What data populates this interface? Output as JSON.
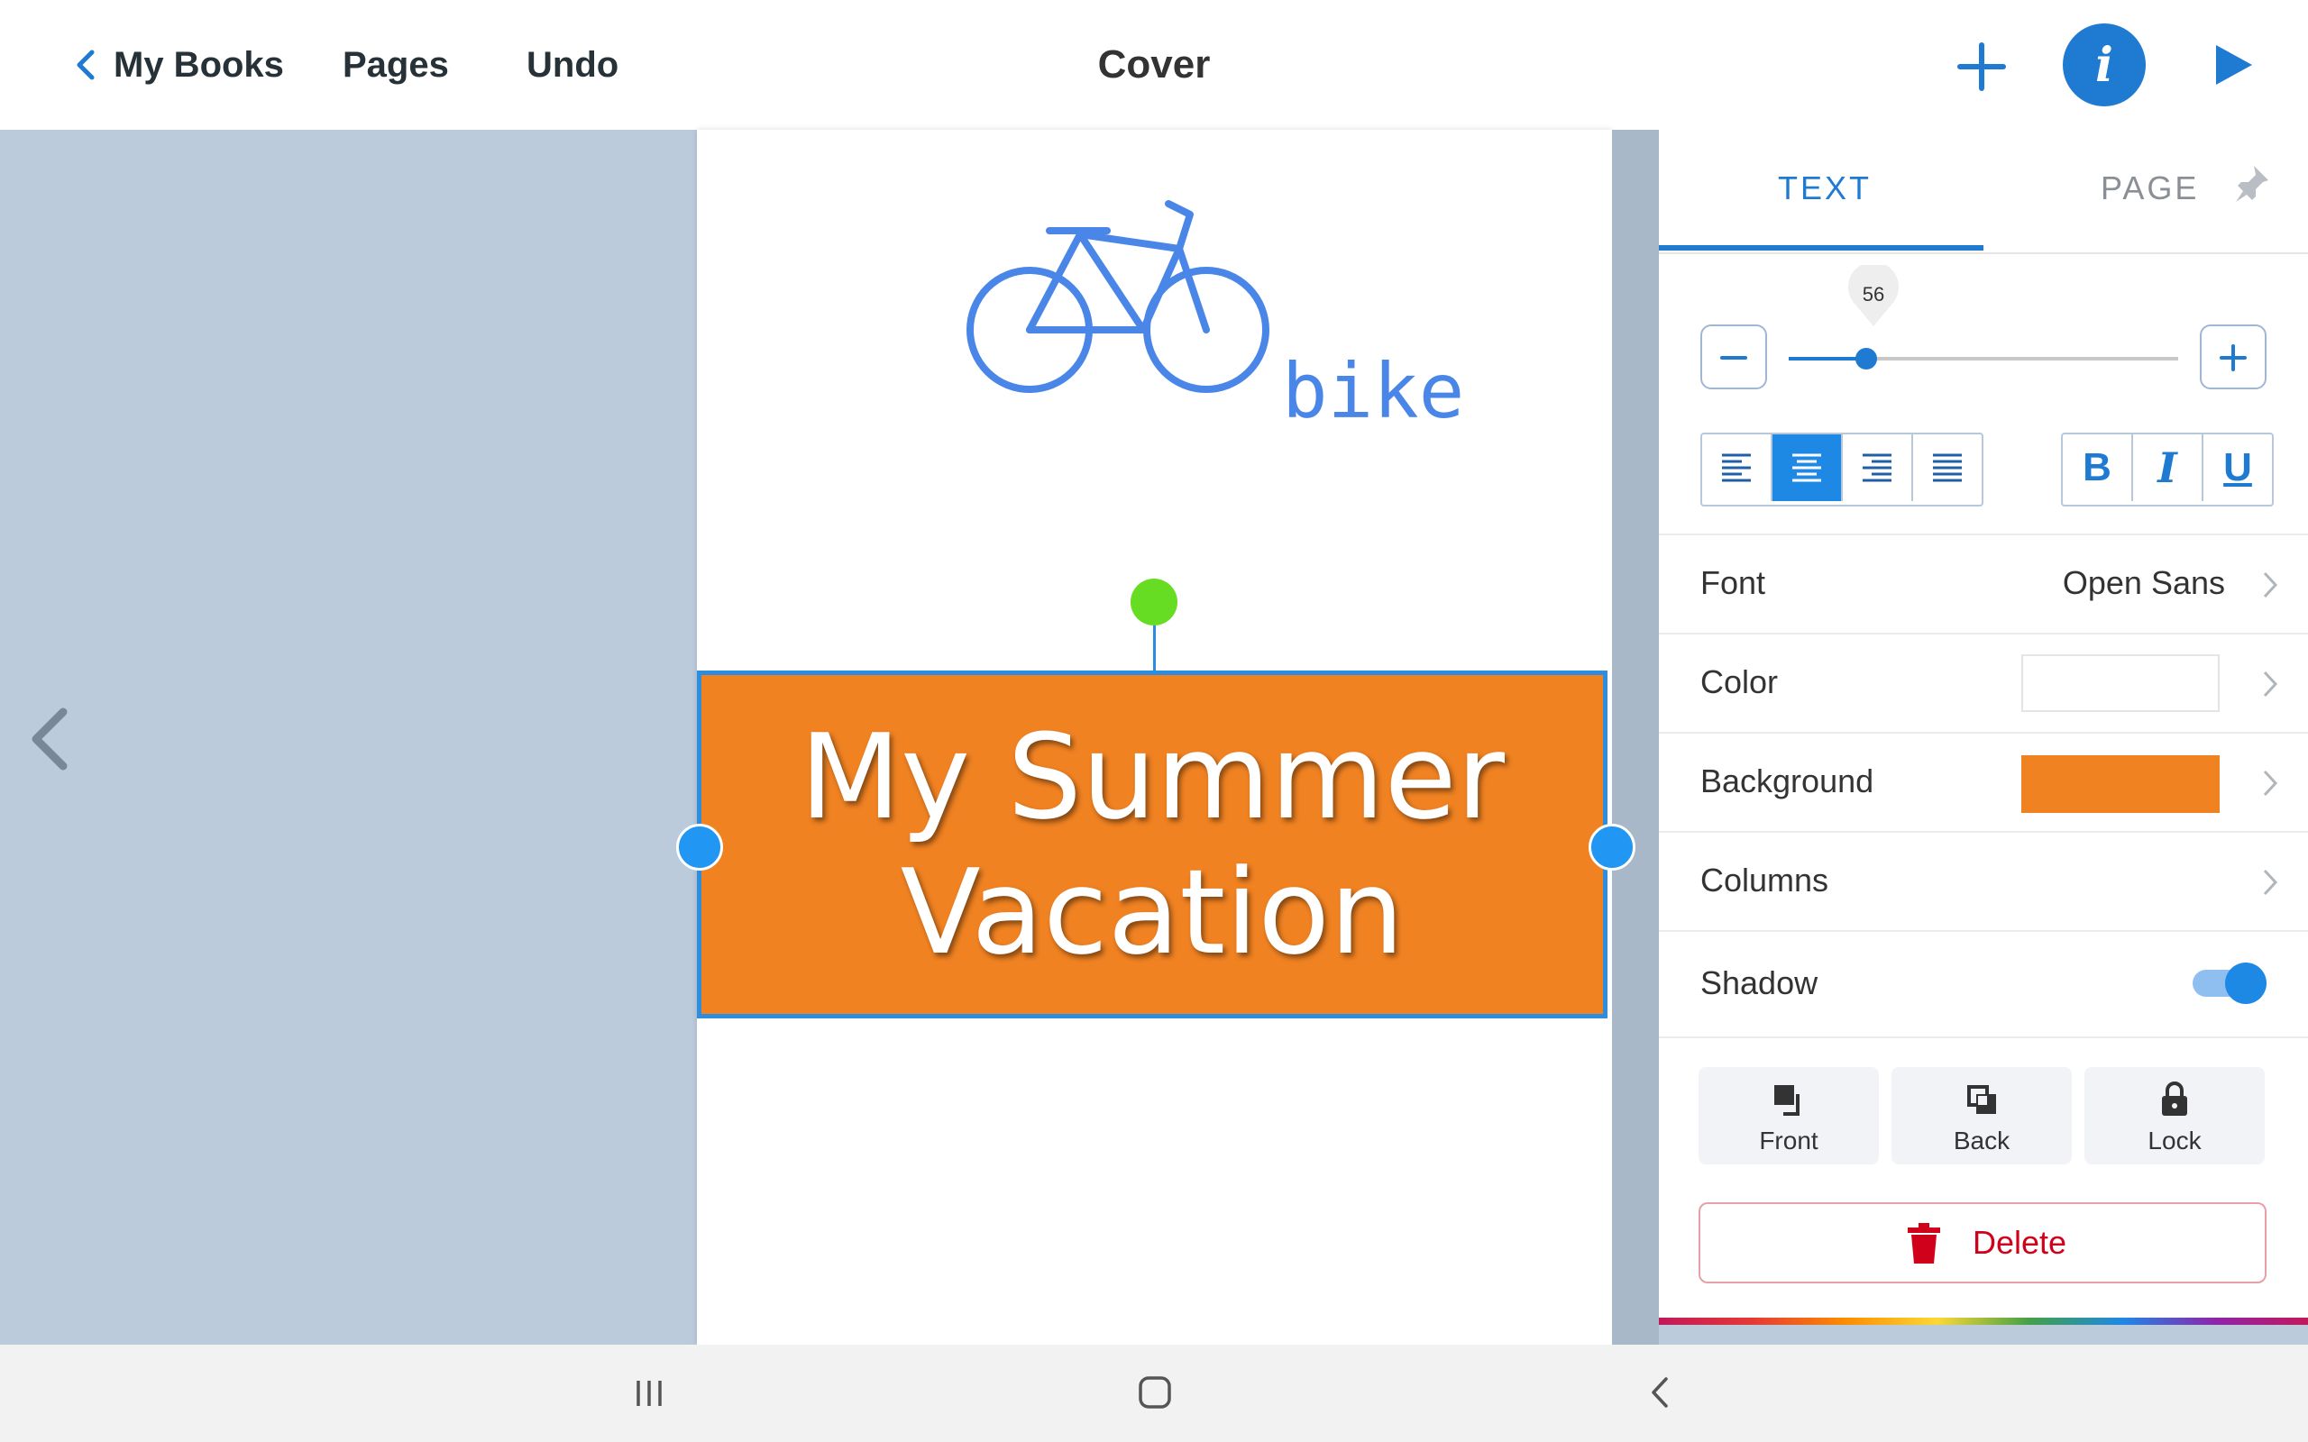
{
  "topbar": {
    "back_label": "My Books",
    "pages_label": "Pages",
    "undo_label": "Undo",
    "title": "Cover",
    "icons": [
      "chevron-left-icon",
      "plus-icon",
      "info-icon",
      "play-icon"
    ],
    "accent_color": "#1f7ad1"
  },
  "canvas": {
    "logo_text": "bike",
    "title_text_line1": "My Summer",
    "title_text_line2": "Vacation",
    "text_box_color": "#f08222",
    "workspace_color": "#bccbdc"
  },
  "panel": {
    "tabs": [
      {
        "label": "TEXT",
        "active": true
      },
      {
        "label": "PAGE",
        "active": false
      }
    ],
    "font_size": "56",
    "font_size_value": 56,
    "font_size_fraction": 0.2,
    "align_options": [
      "left",
      "center",
      "right",
      "justify"
    ],
    "align_selected": "center",
    "style_options": [
      "B",
      "I",
      "U"
    ],
    "rows": {
      "font": {
        "label": "Font",
        "value": "Open Sans"
      },
      "color": {
        "label": "Color",
        "value": "#ffffff"
      },
      "background": {
        "label": "Background",
        "value": "#f08222"
      },
      "columns": {
        "label": "Columns"
      },
      "shadow": {
        "label": "Shadow",
        "on": true
      }
    },
    "actions": [
      {
        "label": "Front",
        "icon": "bring-to-front-icon"
      },
      {
        "label": "Back",
        "icon": "send-to-back-icon"
      },
      {
        "label": "Lock",
        "icon": "lock-icon"
      }
    ],
    "delete_label": "Delete"
  },
  "system_nav": [
    "recents-icon",
    "home-icon",
    "back-icon"
  ]
}
